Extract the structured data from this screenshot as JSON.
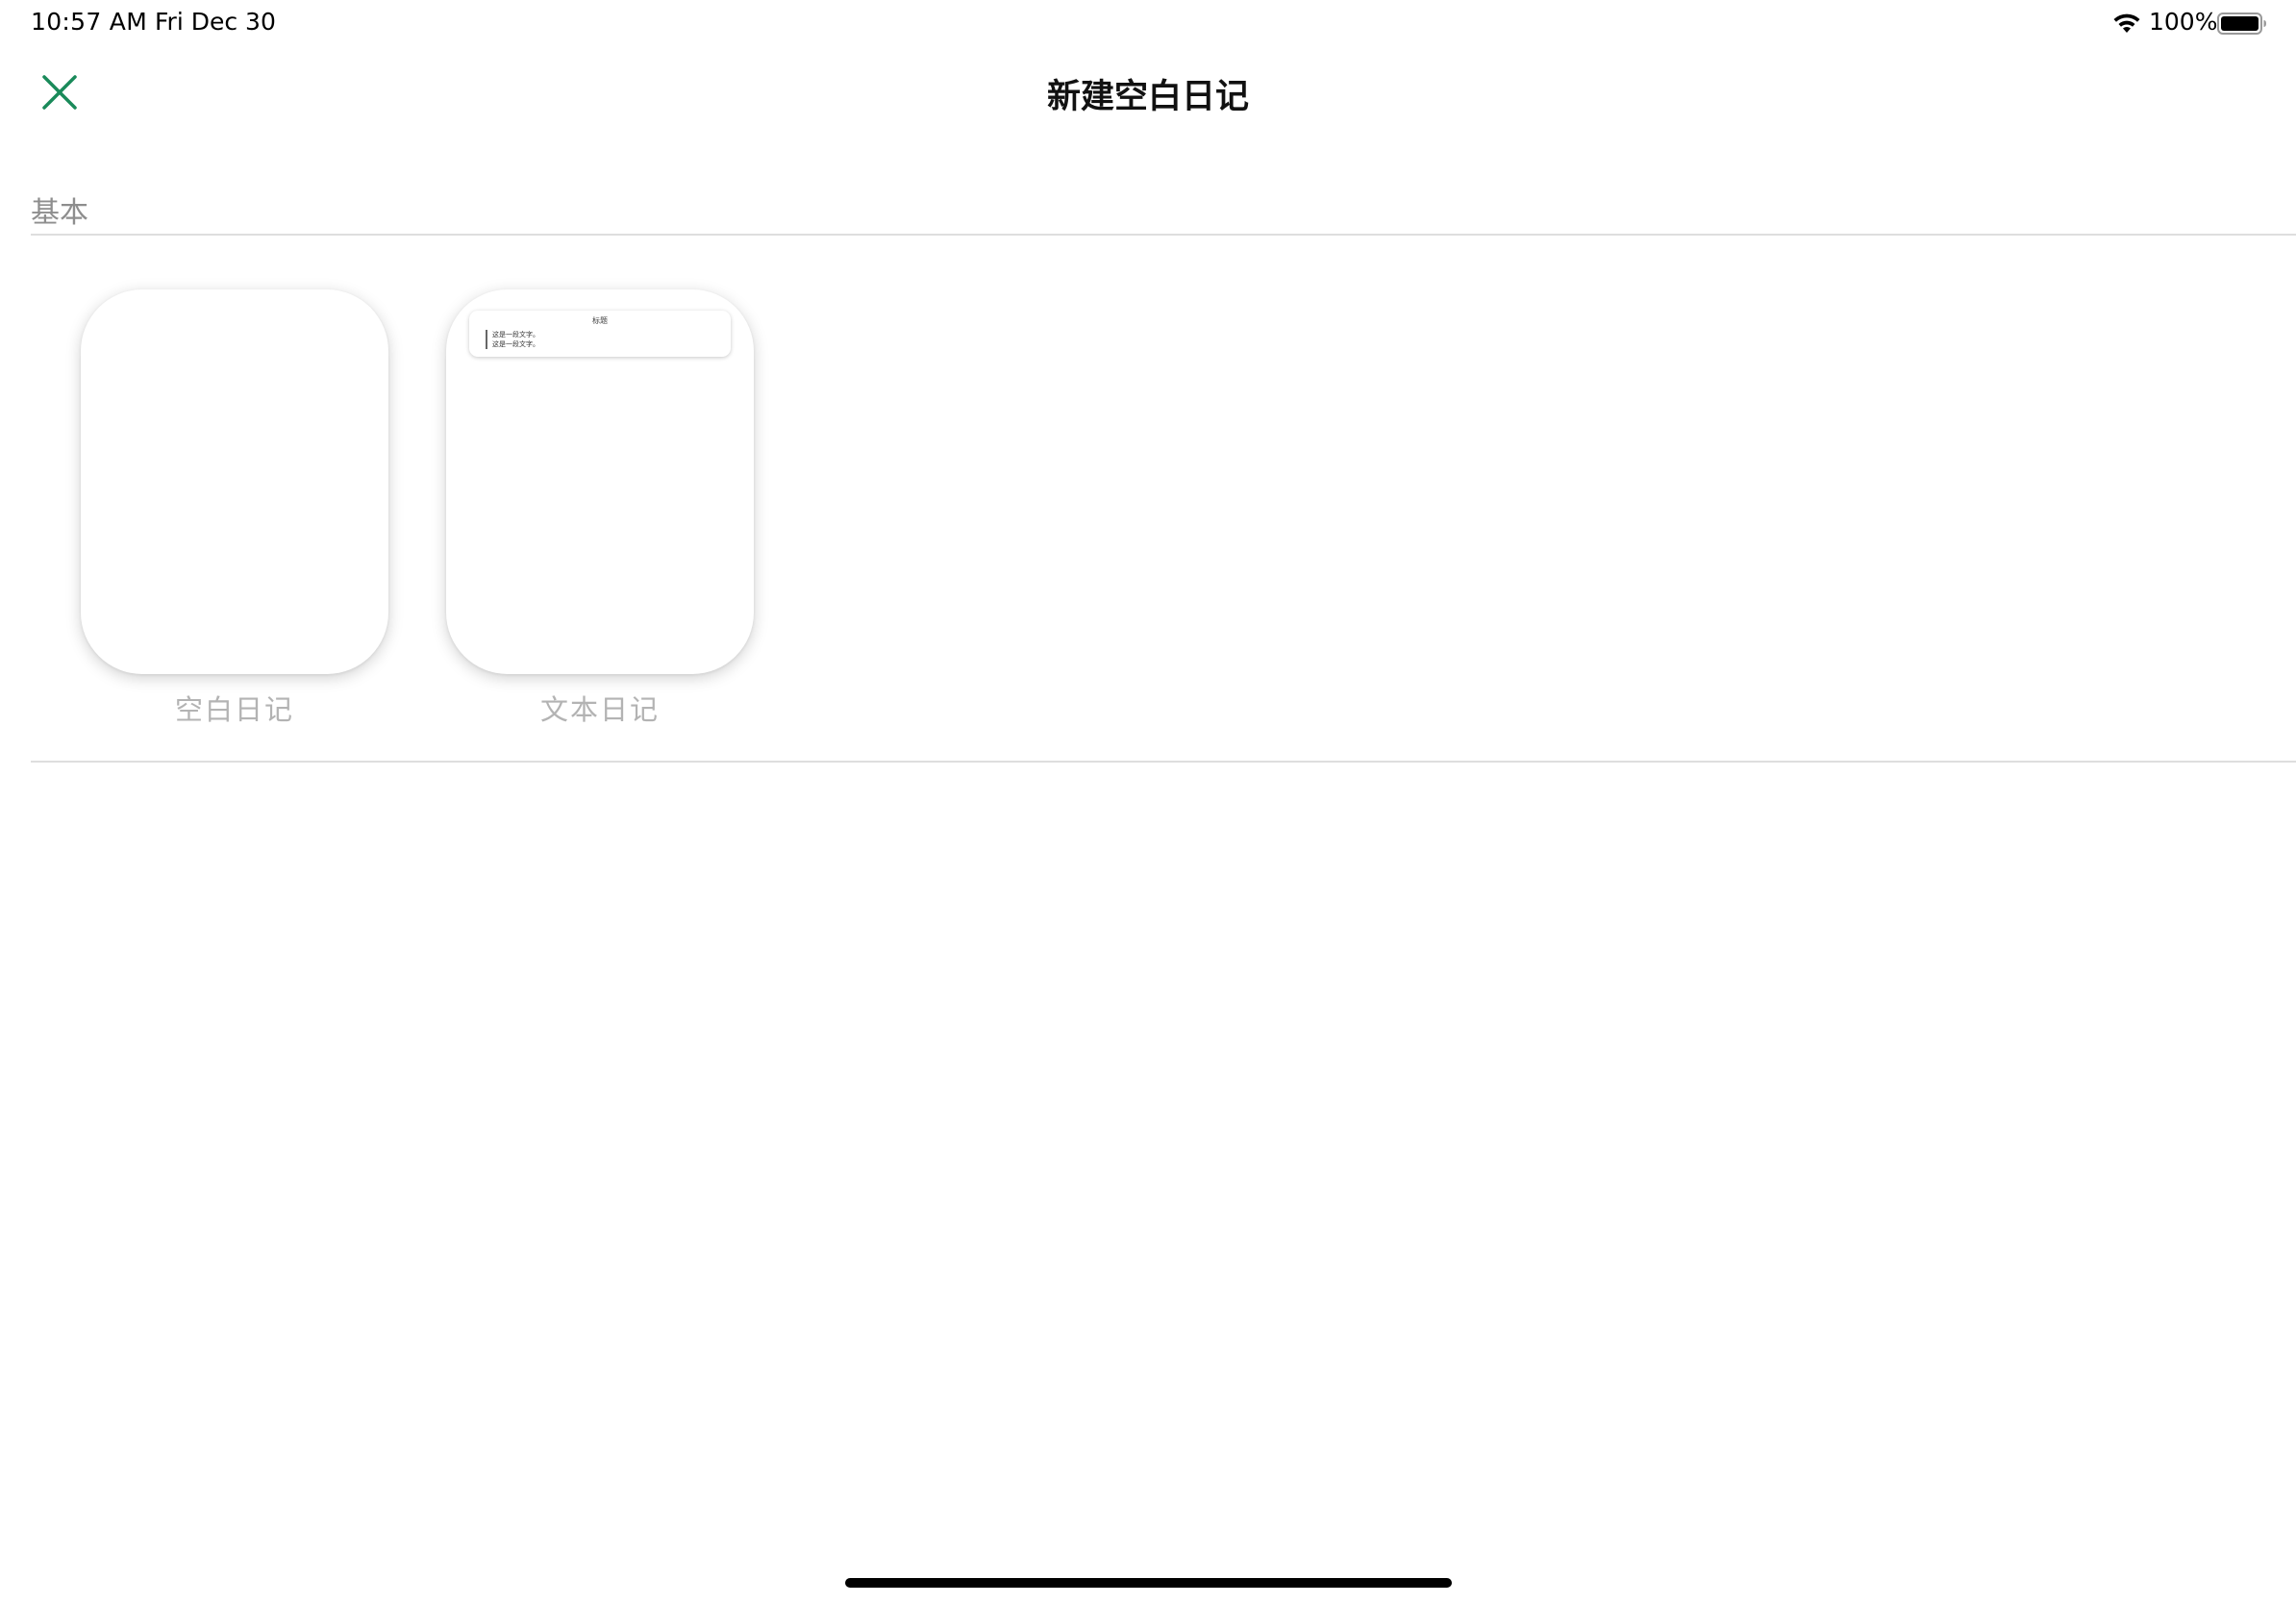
{
  "status_bar": {
    "time": "10:57 AM",
    "date": "Fri Dec 30",
    "battery_percent": "100%",
    "battery_level": 1.0,
    "icons": [
      "wifi-icon",
      "battery-icon"
    ]
  },
  "nav": {
    "title": "新建空白日记",
    "close_icon": "close-icon",
    "accent_color": "#1a8a5a"
  },
  "section": {
    "header": "基本"
  },
  "templates": [
    {
      "label": "空白日记"
    },
    {
      "label": "文本日记",
      "preview": {
        "title": "标题",
        "lines": [
          "这是一段文字。",
          "这是一段文字。"
        ]
      }
    }
  ]
}
